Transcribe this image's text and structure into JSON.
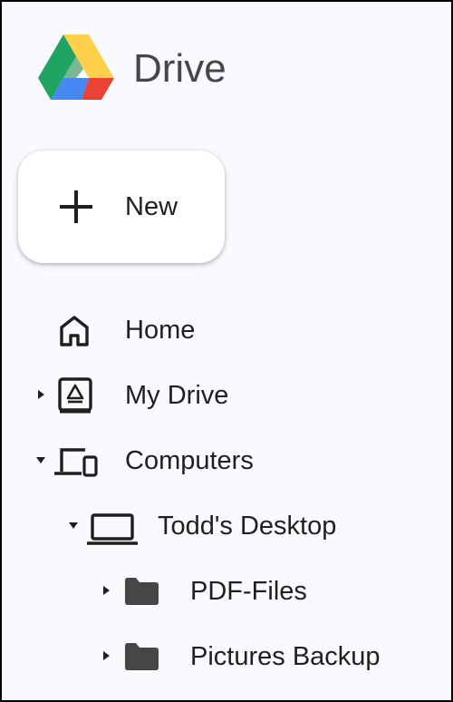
{
  "app": {
    "title": "Drive"
  },
  "new_button": {
    "label": "New"
  },
  "nav": {
    "home": {
      "label": "Home",
      "icon": "home-icon"
    },
    "my_drive": {
      "label": "My Drive",
      "icon": "drive-icon",
      "expanded": false
    },
    "computers": {
      "label": "Computers",
      "icon": "computers-icon",
      "expanded": true
    },
    "todds_desktop": {
      "label": "Todd's Desktop",
      "icon": "laptop-icon",
      "expanded": true
    },
    "pdf_files": {
      "label": "PDF-Files",
      "icon": "folder-icon",
      "expanded": false
    },
    "pictures_backup": {
      "label": "Pictures Backup",
      "icon": "folder-icon",
      "expanded": false
    }
  },
  "colors": {
    "sidebar_bg": "#f8fafd",
    "text": "#1f1f1f",
    "icon": "#1f1f1f",
    "brand_text": "#444746",
    "logo_green": "#1fa463",
    "logo_yellow": "#ffd04b",
    "logo_blue": "#4688f4",
    "logo_red": "#ea4335"
  }
}
